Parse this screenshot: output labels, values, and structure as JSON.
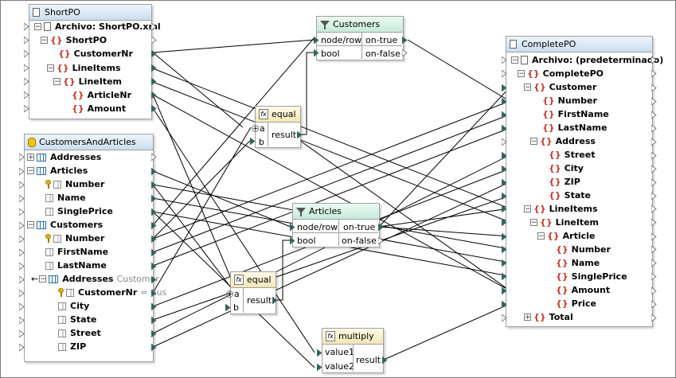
{
  "shortpo": {
    "title": "ShortPO",
    "rows": [
      "Archivo: ShortPO.xml",
      "ShortPO",
      "CustomerNr",
      "LineItems",
      "LineItem",
      "ArticleNr",
      "Amount"
    ]
  },
  "customers_filter": {
    "title": "Customers",
    "in_ports": [
      "node/row",
      "bool"
    ],
    "out_ports": [
      "on-true",
      "on-false"
    ]
  },
  "equal1": {
    "title": "equal",
    "in_ports": [
      "a",
      "b"
    ],
    "out": "result"
  },
  "cust_articles": {
    "title": "CustomersAndArticles",
    "rows": [
      "Addresses",
      "Articles",
      "Number",
      "Name",
      "SinglePrice",
      "Customers",
      "Number",
      "FirstName",
      "LastName",
      "Addresses",
      "CustomerNr",
      "City",
      "State",
      "Street",
      "ZIP"
    ],
    "addresses_hint": "Customer",
    "customernr_hint": "= Cus"
  },
  "articles_filter": {
    "title": "Articles",
    "in_ports": [
      "node/row",
      "bool"
    ],
    "out_ports": [
      "on-true",
      "on-false"
    ]
  },
  "equal2": {
    "title": "equal",
    "in_ports": [
      "a",
      "b"
    ],
    "out": "result"
  },
  "multiply": {
    "title": "multiply",
    "in_ports": [
      "value1",
      "value2"
    ],
    "out": "result"
  },
  "completepo": {
    "title": "CompletePO",
    "rows": [
      "Archivo: (predeterminado)",
      "CompletePO",
      "Customer",
      "Number",
      "FirstName",
      "LastName",
      "Address",
      "Street",
      "City",
      "ZIP",
      "State",
      "LineItems",
      "LineItem",
      "Article",
      "Number",
      "Name",
      "SinglePrice",
      "Amount",
      "Price",
      "Total"
    ]
  }
}
